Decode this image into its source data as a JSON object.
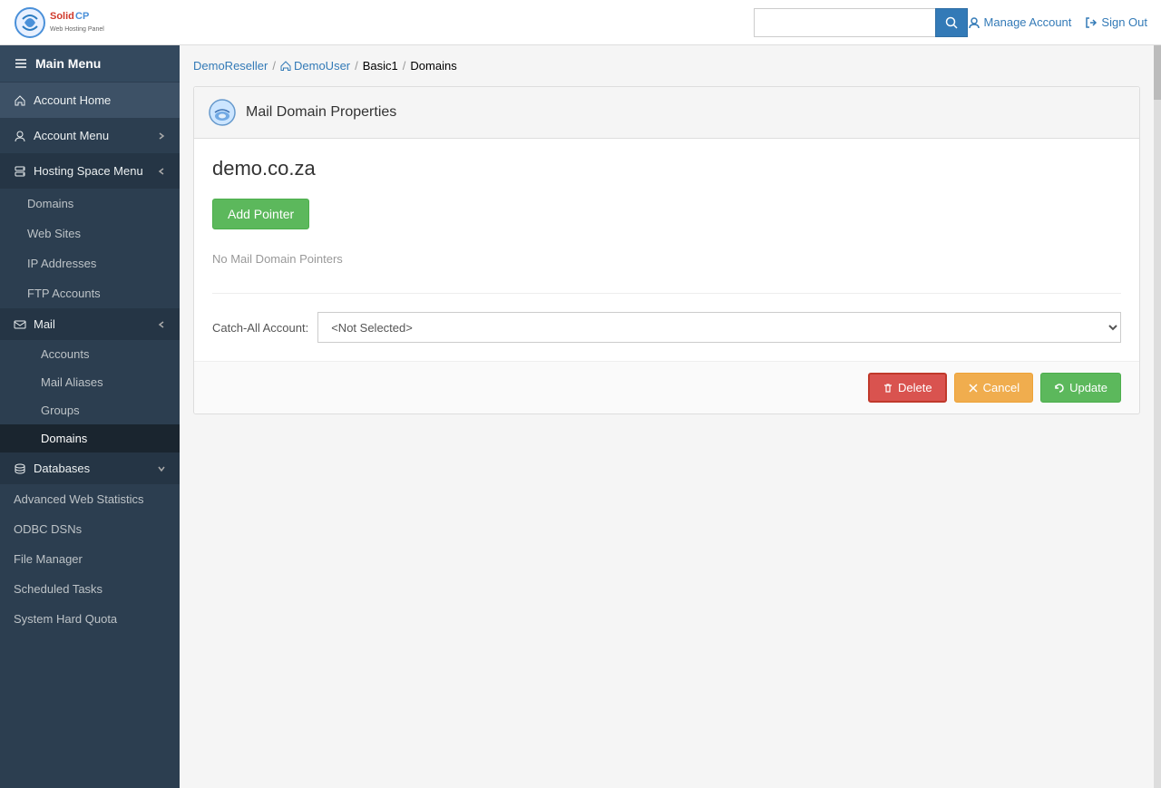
{
  "brand": {
    "name": "SolidCP",
    "logo_text": "SolidCP"
  },
  "navbar": {
    "search_placeholder": "",
    "manage_account_label": "Manage Account",
    "sign_out_label": "Sign Out"
  },
  "sidebar": {
    "main_menu_label": "Main Menu",
    "account_home_label": "Account Home",
    "account_menu_label": "Account Menu",
    "hosting_space_menu_label": "Hosting Space Menu",
    "items": [
      {
        "label": "Domains"
      },
      {
        "label": "Web Sites"
      },
      {
        "label": "IP Addresses"
      },
      {
        "label": "FTP Accounts"
      }
    ],
    "mail_label": "Mail",
    "mail_subitems": [
      {
        "label": "Accounts",
        "active": false
      },
      {
        "label": "Mail Aliases"
      },
      {
        "label": "Groups"
      },
      {
        "label": "Domains",
        "active": true
      }
    ],
    "databases_label": "Databases",
    "advanced_web_stats_label": "Advanced Web Statistics",
    "odbc_dsns_label": "ODBC DSNs",
    "file_manager_label": "File Manager",
    "scheduled_tasks_label": "Scheduled Tasks",
    "system_hard_quota_label": "System Hard Quota"
  },
  "breadcrumb": {
    "reseller": "DemoReseller",
    "user": "DemoUser",
    "package": "Basic1",
    "current": "Domains"
  },
  "panel": {
    "title": "Mail Domain Properties",
    "domain_name": "demo.co.za",
    "add_pointer_label": "Add Pointer",
    "no_pointers_text": "No Mail Domain Pointers",
    "catch_all_label": "Catch-All Account:",
    "catch_all_placeholder": "<Not Selected>",
    "delete_label": "Delete",
    "cancel_label": "Cancel",
    "update_label": "Update"
  }
}
